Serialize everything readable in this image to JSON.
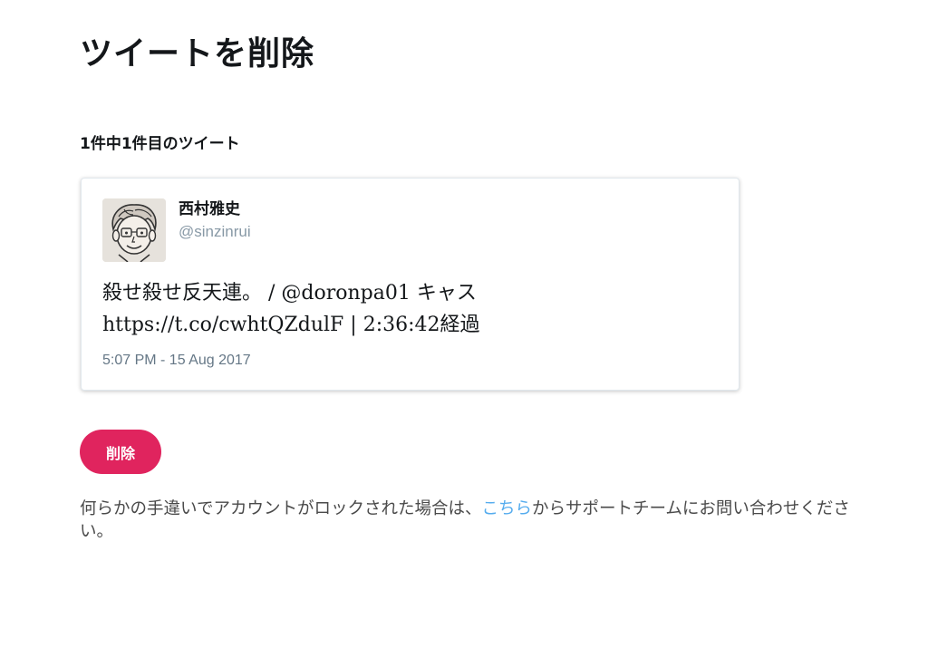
{
  "page": {
    "title": "ツイートを削除",
    "tweet_count": "1件中1件目のツイート"
  },
  "tweet": {
    "display_name": "西村雅史",
    "screen_name": "@sinzinrui",
    "text": "殺せ殺せ反天連。 / @doronpa01 キャス\nhttps://t.co/cwhtQZdulF | 2:36:42経過",
    "timestamp": "5:07 PM - 15 Aug 2017",
    "avatar_icon": "cartoon-face-avatar-icon"
  },
  "actions": {
    "delete_label": "削除",
    "delete_color": "#e0245e"
  },
  "support": {
    "text_before": "何らかの手違いでアカウントがロックされた場合は、",
    "link_text": "こちら",
    "text_after": "からサポートチームにお問い合わせください。",
    "link_color": "#55acee"
  }
}
